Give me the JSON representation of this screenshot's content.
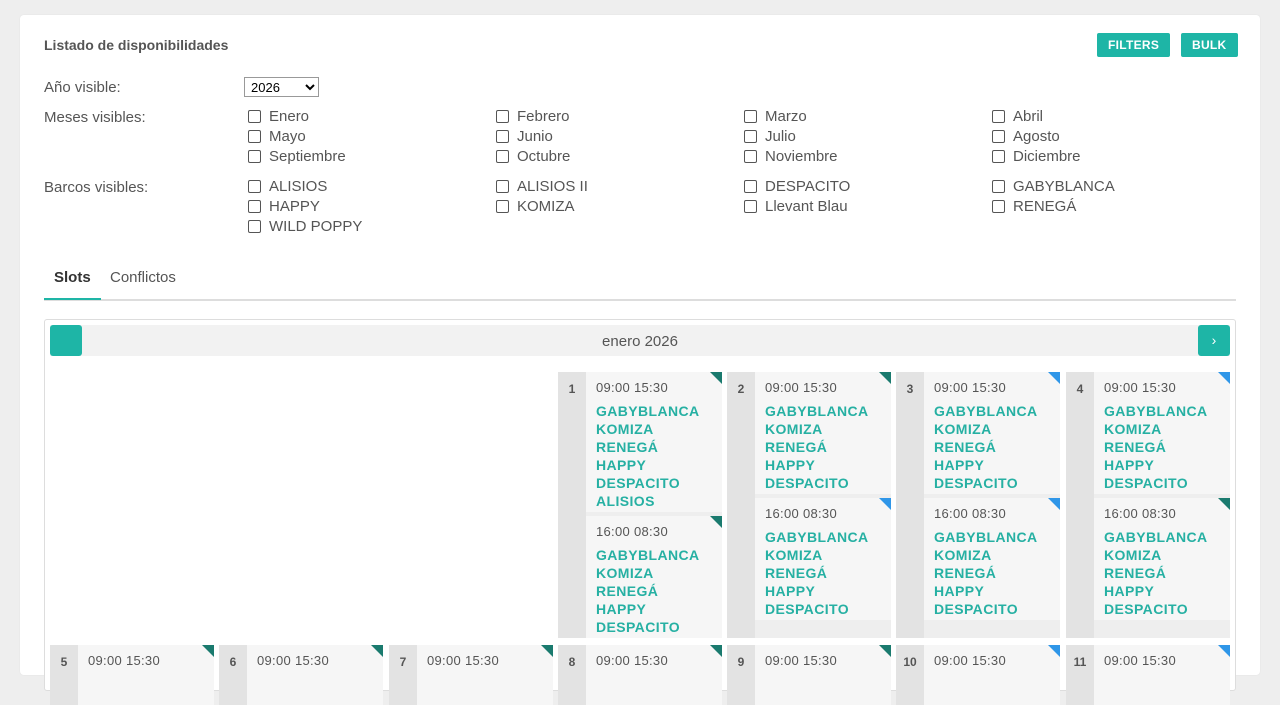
{
  "header": {
    "title": "Listado de disponibilidades",
    "filters_label": "FILTERS",
    "bulk_label": "BULK"
  },
  "year": {
    "label": "Año visible:",
    "selected": "2026"
  },
  "months": {
    "label": "Meses visibles:",
    "items": [
      "Enero",
      "Febrero",
      "Marzo",
      "Abril",
      "Mayo",
      "Junio",
      "Julio",
      "Agosto",
      "Septiembre",
      "Octubre",
      "Noviembre",
      "Diciembre"
    ]
  },
  "boats": {
    "label": "Barcos visibles:",
    "items": [
      "ALISIOS",
      "ALISIOS II",
      "DESPACITO",
      "GABYBLANCA",
      "HAPPY",
      "KOMIZA",
      "Llevant Blau",
      "RENEGÁ",
      "WILD POPPY"
    ]
  },
  "tabs": [
    "Slots",
    "Conflictos"
  ],
  "calendar": {
    "month_label": "enero 2026",
    "next_icon": "›",
    "colors": {
      "accent": "#1eb5a6",
      "corner_green": "#1a7a6e",
      "corner_blue": "#2f96e8"
    },
    "days": [
      {
        "num": "1",
        "slots": [
          {
            "time": "09:00 15:30",
            "boats": "GABYBLANCA\nKOMIZA\nRENEGÁ\nHAPPY\nDESPACITO\nALISIOS",
            "corner": "green"
          },
          {
            "time": "16:00 08:30",
            "boats": "GABYBLANCA\nKOMIZA\nRENEGÁ\nHAPPY\nDESPACITO",
            "corner": "green"
          }
        ]
      },
      {
        "num": "2",
        "slots": [
          {
            "time": "09:00 15:30",
            "boats": "GABYBLANCA\nKOMIZA\nRENEGÁ\nHAPPY\nDESPACITO",
            "corner": "green"
          },
          {
            "time": "16:00 08:30",
            "boats": "GABYBLANCA\nKOMIZA\nRENEGÁ\nHAPPY\nDESPACITO",
            "corner": "blue"
          }
        ]
      },
      {
        "num": "3",
        "slots": [
          {
            "time": "09:00 15:30",
            "boats": "GABYBLANCA\nKOMIZA\nRENEGÁ\nHAPPY\nDESPACITO",
            "corner": "blue"
          },
          {
            "time": "16:00 08:30",
            "boats": "GABYBLANCA\nKOMIZA\nRENEGÁ\nHAPPY\nDESPACITO",
            "corner": "blue"
          }
        ]
      },
      {
        "num": "4",
        "slots": [
          {
            "time": "09:00 15:30",
            "boats": "GABYBLANCA\nKOMIZA\nRENEGÁ\nHAPPY\nDESPACITO",
            "corner": "blue"
          },
          {
            "time": "16:00 08:30",
            "boats": "GABYBLANCA\nKOMIZA\nRENEGÁ\nHAPPY\nDESPACITO",
            "corner": "green"
          }
        ]
      }
    ],
    "week2": [
      {
        "num": "5",
        "time": "09:00 15:30",
        "corner": "green"
      },
      {
        "num": "6",
        "time": "09:00 15:30",
        "corner": "green"
      },
      {
        "num": "7",
        "time": "09:00 15:30",
        "corner": "green"
      },
      {
        "num": "8",
        "time": "09:00 15:30",
        "corner": "green"
      },
      {
        "num": "9",
        "time": "09:00 15:30",
        "corner": "green"
      },
      {
        "num": "10",
        "time": "09:00 15:30",
        "corner": "blue"
      },
      {
        "num": "11",
        "time": "09:00 15:30",
        "corner": "blue"
      }
    ]
  }
}
